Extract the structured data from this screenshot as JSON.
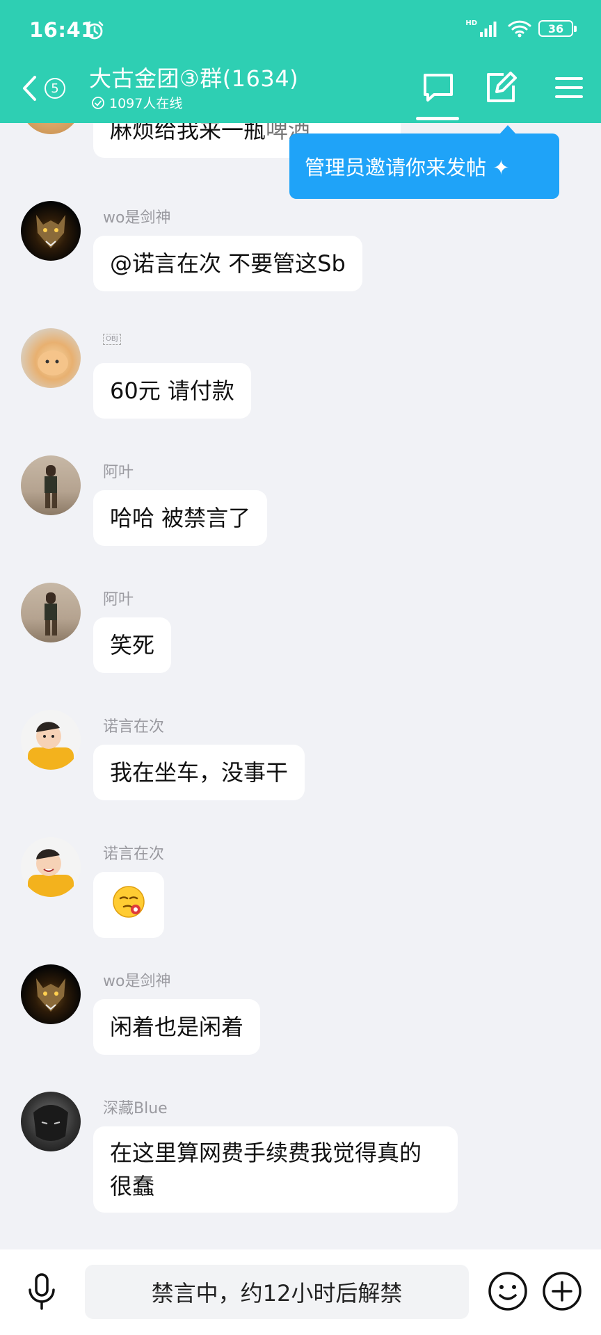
{
  "status_bar": {
    "time": "16:41",
    "network": "HD",
    "battery": "36"
  },
  "header": {
    "unread_count": "5",
    "title": "大古金团③群(1634)",
    "online": "1097人在线",
    "icons": [
      "chat-tab-icon",
      "edit-post-icon",
      "menu-icon"
    ]
  },
  "tooltip": {
    "text": "管理员邀请你来发帖 ✦"
  },
  "messages": [
    {
      "sender": "",
      "text": "麻烦给我来一瓶",
      "cut": "啤酒"
    },
    {
      "sender": "wo是剑神",
      "text": "@诺言在次 不要管这Sb"
    },
    {
      "sender": "OBJ",
      "text": "60元  请付款"
    },
    {
      "sender": "阿叶",
      "text": "哈哈 被禁言了"
    },
    {
      "sender": "阿叶",
      "text": "笑死"
    },
    {
      "sender": "诺言在次",
      "text": "我在坐车，没事干"
    },
    {
      "sender": "诺言在次",
      "emoji": "smug-emoji"
    },
    {
      "sender": "wo是剑神",
      "text": "闲着也是闲着"
    },
    {
      "sender": "深藏Blue",
      "line1": "在这里算网费手续费我觉得真的",
      "line2": "很蠢"
    }
  ],
  "bottom_bar": {
    "mute_status": "禁言中，约12小时后解禁"
  },
  "colors": {
    "header": "#2ecfb3",
    "tooltip": "#1fa3f8",
    "background": "#f1f2f6"
  }
}
